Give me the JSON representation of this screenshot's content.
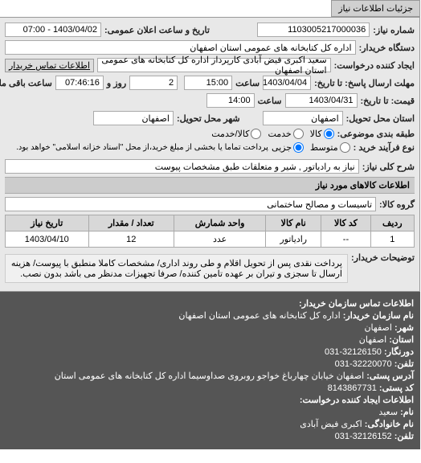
{
  "tab": {
    "title": "جزئیات اطلاعات نیاز"
  },
  "header": {
    "req_number_label": "شماره نیاز:",
    "req_number": "1103005217000036",
    "announce_label": "تاریخ و ساعت اعلان عمومی:",
    "announce_value": "1403/04/02 - 07:00",
    "buyer_label": "دستگاه خریدار:",
    "buyer": "اداره کل کتابخانه های عمومی استان اصفهان",
    "requester_label": "ایجاد کننده درخواست:",
    "requester": "سعید اکبری فیض آبادی کارپرداز اداره کل کتابخانه های عمومی استان اصفهان",
    "contact_btn": "اطلاعات تماس خریدار",
    "deadline_send_label": "مهلت ارسال پاسخ: تا تاریخ:",
    "deadline_send_date": "1403/04/04",
    "time_label": "ساعت",
    "deadline_send_time": "15:00",
    "day_remaining": "2",
    "day_remaining_label": "روز و",
    "time_remaining": "07:46:16",
    "time_remaining_label": "ساعت باقی مانده",
    "price_deadline_label": "قیمت: تا تاریخ:",
    "price_deadline_date": "1403/04/31",
    "price_deadline_time": "14:00",
    "province_label": "استان محل تحویل:",
    "province": "اصفهان",
    "city_label": "شهر محل تحویل:",
    "city": "اصفهان",
    "pkg_label": "طبقه بندی موضوعی:",
    "radio_goods": "کالا",
    "radio_service": "خدمت",
    "radio_both": "کالا/خدمت",
    "process_label": "نوع فرآیند خرید :",
    "radio_medium": "متوسط",
    "radio_minor": "جزیی",
    "process_text": "پرداخت تماما یا بخشی از مبلغ خرید،از محل \"اسناد خزانه اسلامی\" خواهد بود."
  },
  "item": {
    "title_label": "شرح کلی نیاز:",
    "title_value": "نیاز به رادیاتور , شیر و متعلقات طبق مشخصات پیوست"
  },
  "goods_section": {
    "title": "اطلاعات کالاهای مورد نیاز"
  },
  "group": {
    "label": "گروه کالا:",
    "value": "تاسیسات و مصالح ساختمانی"
  },
  "table": {
    "headers": [
      "ردیف",
      "کد کالا",
      "نام کالا",
      "واحد شمارش",
      "تعداد / مقدار",
      "تاریخ نیاز"
    ],
    "row": [
      "1",
      "--",
      "رادیاتور",
      "عدد",
      "12",
      "1403/04/10"
    ]
  },
  "notes": {
    "label": "توضیحات خریدار:",
    "text": "پرداخت نقدی پس از تحویل اقلام و طی روند اداری/ مشخصات کاملا منطبق با پیوست/ هزینه ارسال تا سجزی و تیران بر عهده تامین کننده/ صرفا تجهیزات مدنظر می باشد بدون نصب."
  },
  "contact": {
    "section_title": "اطلاعات تماس سازمان خریدار:",
    "org_label": "نام سازمان خریدار:",
    "org": "اداره کل کتابخانه های عمومی استان اصفهان",
    "city_label": "شهر:",
    "city": "اصفهان",
    "province_label": "استان:",
    "province": "اصفهان",
    "fax_label": "دورنگار:",
    "fax": "32126150-031",
    "tel_label": "تلفن:",
    "tel": "32220070-031",
    "address_label": "آدرس پستی:",
    "address": "اصفهان خیابان چهارباغ خواجو روبروی صداوسیما اداره کل کتابخانه های عمومی استان",
    "postal_label": "کد پستی:",
    "postal": "8143867731",
    "creator_section": "اطلاعات ایجاد کننده درخواست:",
    "name_label": "نام:",
    "name": "سعید",
    "lname_label": "نام خانوادگی:",
    "lname": "اکبری فیض آبادی",
    "tel2_label": "تلفن:",
    "tel2": "32126152-031"
  }
}
